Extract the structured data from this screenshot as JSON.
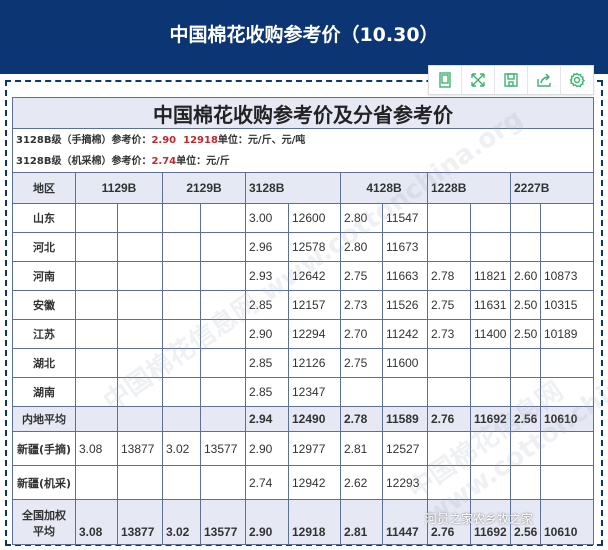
{
  "header": {
    "title": "中国棉花收购参考价（10.30）"
  },
  "toolbar": {
    "icons": [
      "tablet-icon",
      "fullscreen-icon",
      "save-icon",
      "share-icon",
      "settings-icon"
    ]
  },
  "table": {
    "title": "中国棉花收购参考价及分省参考价",
    "info1": {
      "label": "3128B级（手摘棉）参考价：",
      "price": "2.90",
      "ton": "12918",
      "unit": "单位：元/斤、元/吨"
    },
    "info2": {
      "label": "3128B级（机采棉）参考价：",
      "price": "2.74",
      "unit": "单位：元/斤"
    },
    "headers": [
      "地区",
      "1129B",
      "2129B",
      "3128B",
      "4128B",
      "1228B",
      "2227B"
    ],
    "rows": [
      {
        "region": "山东",
        "v": [
          "",
          "",
          "",
          "",
          "3.00",
          "12600",
          "2.80",
          "11547",
          "",
          "",
          "",
          ""
        ]
      },
      {
        "region": "河北",
        "v": [
          "",
          "",
          "",
          "",
          "2.96",
          "12578",
          "2.80",
          "11673",
          "",
          "",
          "",
          ""
        ]
      },
      {
        "region": "河南",
        "v": [
          "",
          "",
          "",
          "",
          "2.93",
          "12642",
          "2.75",
          "11663",
          "2.78",
          "11821",
          "2.60",
          "10873"
        ]
      },
      {
        "region": "安徽",
        "v": [
          "",
          "",
          "",
          "",
          "2.85",
          "12157",
          "2.73",
          "11526",
          "2.75",
          "11631",
          "2.50",
          "10315"
        ]
      },
      {
        "region": "江苏",
        "v": [
          "",
          "",
          "",
          "",
          "2.90",
          "12294",
          "2.70",
          "11242",
          "2.73",
          "11400",
          "2.50",
          "10189"
        ]
      },
      {
        "region": "湖北",
        "v": [
          "",
          "",
          "",
          "",
          "2.85",
          "12126",
          "2.75",
          "11600",
          "",
          "",
          "",
          ""
        ]
      },
      {
        "region": "湖南",
        "v": [
          "",
          "",
          "",
          "",
          "2.85",
          "12347",
          "",
          "",
          "",
          "",
          "",
          ""
        ]
      }
    ],
    "avg": {
      "region": "内地平均",
      "v": [
        "",
        "",
        "",
        "",
        "2.94",
        "12490",
        "2.78",
        "11589",
        "2.76",
        "11692",
        "2.56",
        "10610"
      ]
    },
    "xj": [
      {
        "region": "新疆(手摘)",
        "v": [
          "3.08",
          "13877",
          "3.02",
          "13577",
          "2.90",
          "12977",
          "2.81",
          "12527",
          "",
          "",
          "",
          ""
        ]
      },
      {
        "region": "新疆(机采)",
        "v": [
          "",
          "",
          "",
          "",
          "2.74",
          "12942",
          "2.62",
          "12293",
          "",
          "",
          "",
          ""
        ]
      }
    ],
    "total": {
      "region1": "全国加权",
      "region2": "平均",
      "v": [
        "3.08",
        "13877",
        "3.02",
        "13577",
        "2.90",
        "12918",
        "2.81",
        "11447",
        "2.76",
        "11692",
        "2.56",
        "10610"
      ]
    }
  },
  "watermark": "河员之家农乡牧之家",
  "bg_watermark": "中国棉花信息网 www.cottonchina.org"
}
